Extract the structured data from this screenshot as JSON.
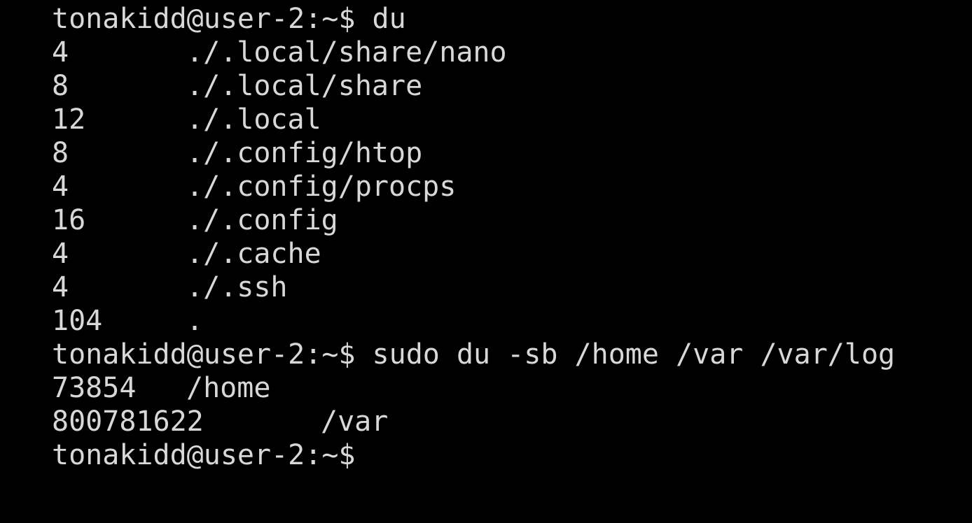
{
  "terminal": {
    "background_color": "#000000",
    "text_color": "#d8d8d8",
    "prompt": "tonakidd@user-2:~$",
    "lines": [
      {
        "type": "command",
        "text": "tonakidd@user-2:~$ du"
      },
      {
        "type": "output",
        "size": "4",
        "path": "./.local/share/nano"
      },
      {
        "type": "output",
        "size": "8",
        "path": "./.local/share"
      },
      {
        "type": "output",
        "size": "12",
        "path": "./.local"
      },
      {
        "type": "output",
        "size": "8",
        "path": "./.config/htop"
      },
      {
        "type": "output",
        "size": "4",
        "path": "./.config/procps"
      },
      {
        "type": "output",
        "size": "16",
        "path": "./.config"
      },
      {
        "type": "output",
        "size": "4",
        "path": "./.cache"
      },
      {
        "type": "output",
        "size": "4",
        "path": "./.ssh"
      },
      {
        "type": "output",
        "size": "104",
        "path": "."
      },
      {
        "type": "command",
        "text": "tonakidd@user-2:~$ sudo du -sb /home /var /var/log"
      },
      {
        "type": "output",
        "size": "73854",
        "path": "/home"
      },
      {
        "type": "output",
        "size": "800781622",
        "path": "/var"
      },
      {
        "type": "command",
        "text": "tonakidd@user-2:~$"
      }
    ]
  }
}
